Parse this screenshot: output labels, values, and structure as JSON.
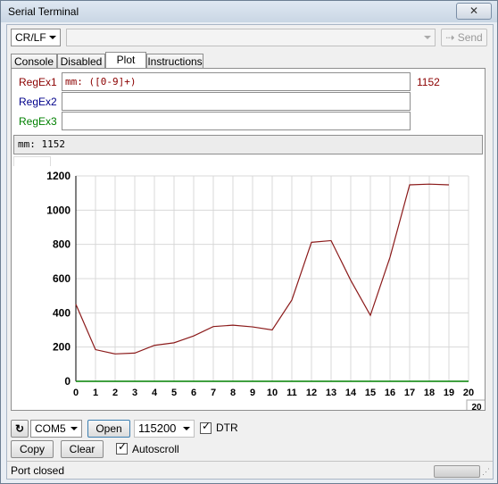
{
  "window": {
    "title": "Serial Terminal",
    "close_label": "✕"
  },
  "toolbar": {
    "line_ending": "CR/LF",
    "send_input": "",
    "send_label": "Send"
  },
  "tabs": [
    {
      "label": "Console",
      "active": false
    },
    {
      "label": "Disabled",
      "active": false
    },
    {
      "label": "Plot",
      "active": true
    },
    {
      "label": "Instructions",
      "active": false
    }
  ],
  "regex": [
    {
      "label": "RegEx1",
      "value": "mm: ([0-9]+)",
      "match": "1152",
      "color": "#8b0000"
    },
    {
      "label": "RegEx2",
      "value": "",
      "color": "#00008b"
    },
    {
      "label": "RegEx3",
      "value": "",
      "color": "#008000"
    }
  ],
  "match_line": "mm: 1152",
  "chart_data": {
    "type": "line",
    "x": [
      0,
      1,
      2,
      3,
      4,
      5,
      6,
      7,
      8,
      9,
      10,
      11,
      12,
      13,
      14,
      15,
      16,
      17,
      18,
      19
    ],
    "series": [
      {
        "values": [
          450,
          185,
          160,
          165,
          210,
          225,
          265,
          320,
          328,
          318,
          300,
          475,
          812,
          822,
          590,
          385,
          725,
          1148,
          1152,
          1148
        ],
        "color": "#8b1a1a"
      }
    ],
    "xlim": [
      0,
      20
    ],
    "ylim": [
      0,
      1200
    ],
    "xticks": [
      "0",
      "1",
      "2",
      "3",
      "4",
      "5",
      "6",
      "7",
      "8",
      "9",
      "10",
      "11",
      "12",
      "13",
      "14",
      "15",
      "16",
      "17",
      "18",
      "19",
      "20"
    ],
    "yticks": [
      "0",
      "200",
      "400",
      "600",
      "800",
      "1000",
      "1200"
    ],
    "scroll_value": "20",
    "grid": true
  },
  "port_controls": {
    "refresh_icon": "refresh-icon",
    "port": "COM5",
    "open_label": "Open",
    "baud": "115200",
    "dtr_label": "DTR",
    "dtr_checked": true
  },
  "actions": {
    "copy_label": "Copy",
    "clear_label": "Clear",
    "autoscroll_label": "Autoscroll",
    "autoscroll_checked": true
  },
  "status": {
    "text": "Port closed"
  }
}
